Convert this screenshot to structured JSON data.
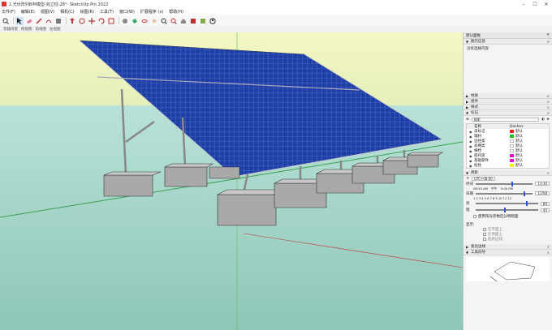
{
  "window": {
    "title": "1.光伏阵列BIM模型-双立柱-28°- SketchUp Pro 2022"
  },
  "menu": [
    "文件(F)",
    "编辑(E)",
    "视图(V)",
    "相机(C)",
    "绘图(R)",
    "工具(T)",
    "窗口(W)",
    "扩展程序 (x)",
    "帮助(H)"
  ],
  "scene_tabs": [
    "等轴场景",
    "俯视图",
    "前视图",
    "左视图"
  ],
  "right_panel": {
    "title": "默认面板",
    "entity_info": {
      "header": "图元信息",
      "content": "没有选择内容"
    },
    "sections": {
      "materials": "材质",
      "components": "组件",
      "styles": "样式",
      "tags": "标记"
    },
    "tags": {
      "search_placeholder": "搜索",
      "col_name": "名称",
      "col_dashes": "Dashes",
      "dash_value": "默认",
      "rows": [
        {
          "name": "未标记",
          "color": "#e02020"
        },
        {
          "name": "辅材",
          "color": "#20c020"
        },
        {
          "name": "边柱类",
          "color": "#ffffff"
        },
        {
          "name": "斜撑类",
          "color": "#ffffff"
        },
        {
          "name": "横档",
          "color": "#ffffff"
        },
        {
          "name": "底托座",
          "color": "#e010d0"
        },
        {
          "name": "基础部件",
          "color": "#e010d0"
        },
        {
          "name": "桩柱",
          "color": "#f0f000"
        }
      ]
    },
    "shadows": {
      "header": "阴影",
      "utc": "UTC+08:00",
      "time_label": "时间",
      "time_start": "06:55 AM",
      "time_noon": "中午",
      "time_end": "5:00 PM",
      "time_value": "13:30",
      "date_label": "日期",
      "months": "1 2 3 4 5 6 7 8 9 10 11 12",
      "date_value": "11/08",
      "light_label": "亮",
      "light_value": "80",
      "dark_label": "暗",
      "dark_value": "45",
      "use_sun_label": "使用阳光参数区分明暗面",
      "display_label": "显示:",
      "on_faces": "在平面上",
      "on_ground": "在地面上",
      "from_edges": "起始边线"
    },
    "sections_bottom": {
      "soften": "柔化边线",
      "instructor": "工具向导"
    }
  }
}
